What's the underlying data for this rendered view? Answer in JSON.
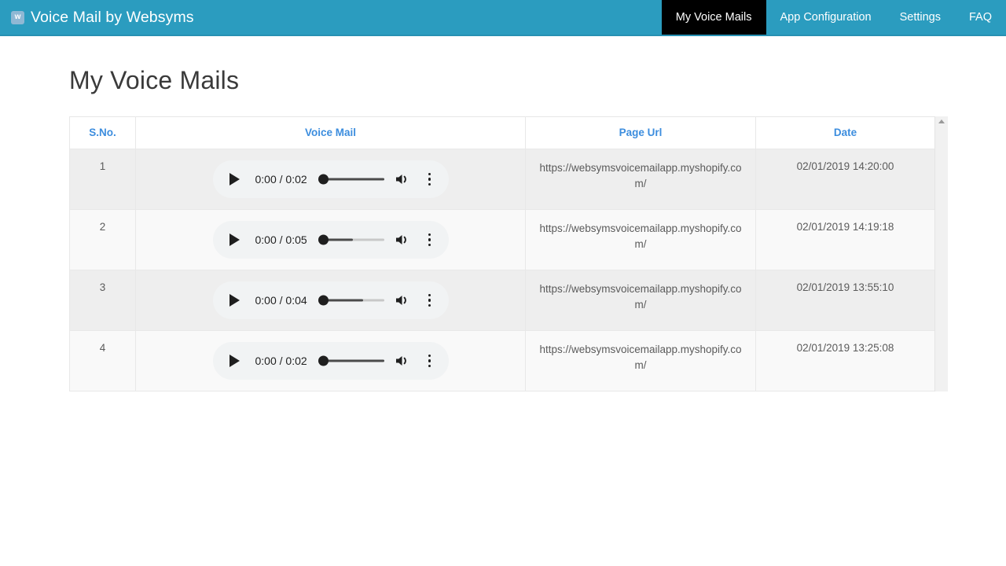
{
  "navbar": {
    "logo_letter": "w",
    "logo_icon": "w-logo-icon",
    "brand": "Voice Mail by Websyms",
    "brand_bg": "#2b9cbf",
    "active_bg": "#000000",
    "links": [
      {
        "label": "My Voice Mails",
        "active": true
      },
      {
        "label": "App Configuration",
        "active": false
      },
      {
        "label": "Settings",
        "active": false
      },
      {
        "label": "FAQ",
        "active": false
      }
    ]
  },
  "page": {
    "title": "My Voice Mails"
  },
  "table": {
    "header_color": "#3c8dde",
    "columns": [
      "S.No.",
      "Voice Mail",
      "Page Url",
      "Date"
    ],
    "rows": [
      {
        "sno": "1",
        "player": {
          "time": "0:00 / 0:02",
          "buffer_percent": 100,
          "progress_percent": 0
        },
        "url": "https://websymsvoicemailapp.myshopify.com/",
        "date": "02/01/2019 14:20:00"
      },
      {
        "sno": "2",
        "player": {
          "time": "0:00 / 0:05",
          "buffer_percent": 52,
          "progress_percent": 0
        },
        "url": "https://websymsvoicemailapp.myshopify.com/",
        "date": "02/01/2019 14:19:18"
      },
      {
        "sno": "3",
        "player": {
          "time": "0:00 / 0:04",
          "buffer_percent": 68,
          "progress_percent": 0
        },
        "url": "https://websymsvoicemailapp.myshopify.com/",
        "date": "02/01/2019 13:55:10"
      },
      {
        "sno": "4",
        "player": {
          "time": "0:00 / 0:02",
          "buffer_percent": 100,
          "progress_percent": 0
        },
        "url": "https://websymsvoicemailapp.myshopify.com/",
        "date": "02/01/2019 13:25:08"
      }
    ],
    "scrollbar": {
      "arrow": "scroll-up-arrow"
    }
  },
  "player_icons": {
    "play": "play-icon",
    "volume": "volume-icon",
    "menu": "more-vertical-icon"
  }
}
